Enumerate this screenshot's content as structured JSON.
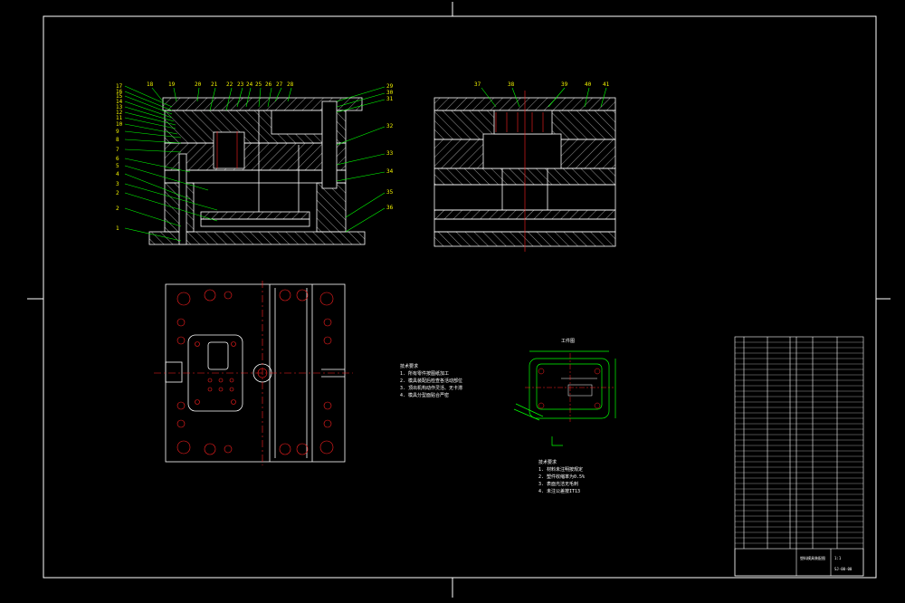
{
  "colors": {
    "background": "#000000",
    "frame": "#ffffff",
    "outline": "#ffffff",
    "leader": "#00ff00",
    "label": "#f5f500",
    "hatch": "#ffffff",
    "center_line": "#ff2020"
  },
  "front_view": {
    "part_numbers": [
      "1",
      "2",
      "3",
      "4",
      "5",
      "6",
      "7",
      "8",
      "9",
      "10",
      "11",
      "12",
      "13",
      "14",
      "15",
      "16",
      "17",
      "18",
      "19",
      "20",
      "21",
      "22",
      "23",
      "24",
      "25",
      "26",
      "27",
      "28",
      "29",
      "30",
      "31",
      "32",
      "33",
      "34",
      "35",
      "36"
    ]
  },
  "side_view": {
    "part_numbers": [
      "37",
      "38",
      "39",
      "40",
      "41"
    ]
  },
  "notes": {
    "tech_title": "技术要求",
    "tech_items": [
      "1. 所有零件按图纸加工",
      "2. 模具装配后检查各活动部位",
      "3. 顶出机构动作灵活、无卡滞",
      "4. 模具分型面贴合严密"
    ],
    "part_title": "工件图",
    "part_items": [
      "1. 材料未注明按规定",
      "2. 塑件收缩率为0.5%",
      "3. 表面光洁无毛刺",
      "4. 未注公差按IT13"
    ]
  },
  "title_block": {
    "title": "塑料模具装配图",
    "drawing_no": "SJ-00-00",
    "sheet": "1:1"
  }
}
